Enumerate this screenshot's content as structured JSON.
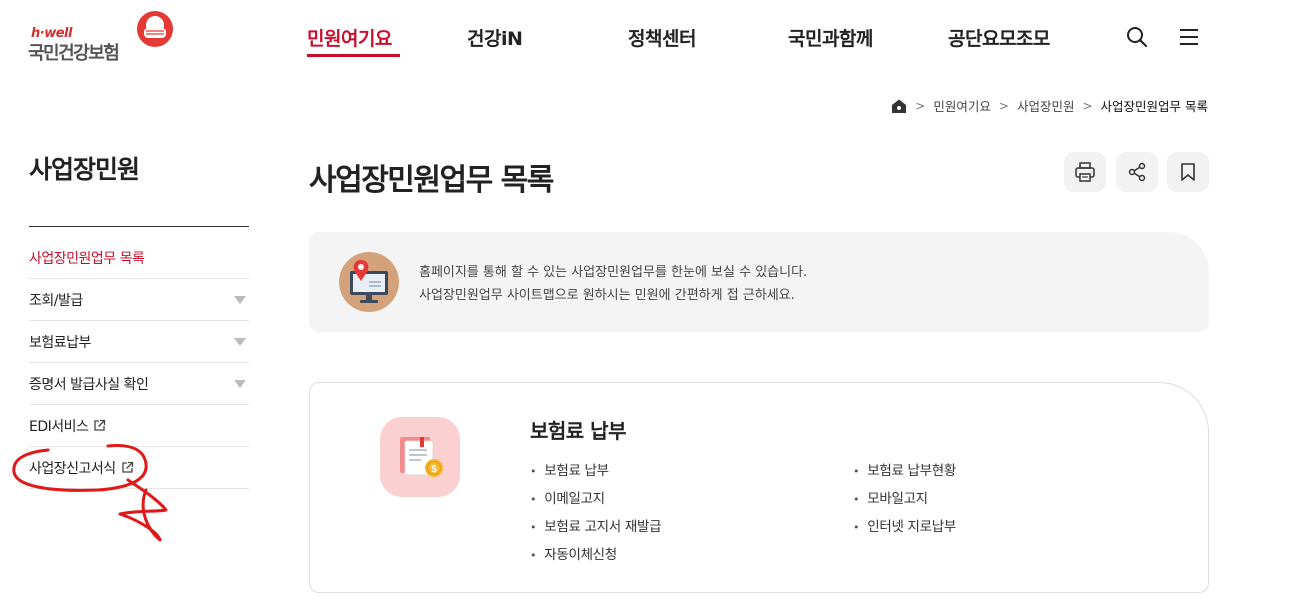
{
  "header": {
    "logo_small": "h·well",
    "logo_main": "국민건강보험",
    "nav": [
      "민원여기요",
      "건강iN",
      "정책센터",
      "국민과함께",
      "공단요모조모"
    ],
    "active_nav": "민원여기요",
    "icons": [
      "search-icon",
      "menu-icon"
    ]
  },
  "breadcrumb": {
    "items": [
      "민원여기요",
      "사업장민원",
      "사업장민원업무 목록"
    ],
    "separator": ">"
  },
  "sidebar": {
    "title": "사업장민원",
    "items": [
      {
        "label": "사업장민원업무 목록",
        "active": true,
        "type": "link"
      },
      {
        "label": "조회/발급",
        "type": "expand"
      },
      {
        "label": "보험료납부",
        "type": "expand"
      },
      {
        "label": "증명서 발급사실 확인",
        "type": "expand"
      },
      {
        "label": "EDI서비스",
        "type": "external"
      },
      {
        "label": "사업장신고서식",
        "type": "external"
      }
    ]
  },
  "main": {
    "title": "사업장민원업무 목록",
    "tools": [
      "print-icon",
      "share-icon",
      "bookmark-icon"
    ],
    "info": {
      "line1": "홈페이지를 통해 할 수 있는 사업장민원업무를 한눈에 보실 수 있습니다.",
      "line2": "사업장민원업무 사이트맵으로 원하시는 민원에 간편하게 접 근하세요."
    },
    "card": {
      "title": "보험료 납부",
      "links": [
        "보험료 납부",
        "보험료 납부현황",
        "이메일고지",
        "모바일고지",
        "보험료 고지서 재발급",
        "인터넷 지로납부",
        "자동이체신청"
      ]
    }
  },
  "colors": {
    "accent": "#c8102e",
    "annotation": "#e01818",
    "panel_bg": "#f4f4f4",
    "card_icon_bg": "#fbd0d0"
  }
}
